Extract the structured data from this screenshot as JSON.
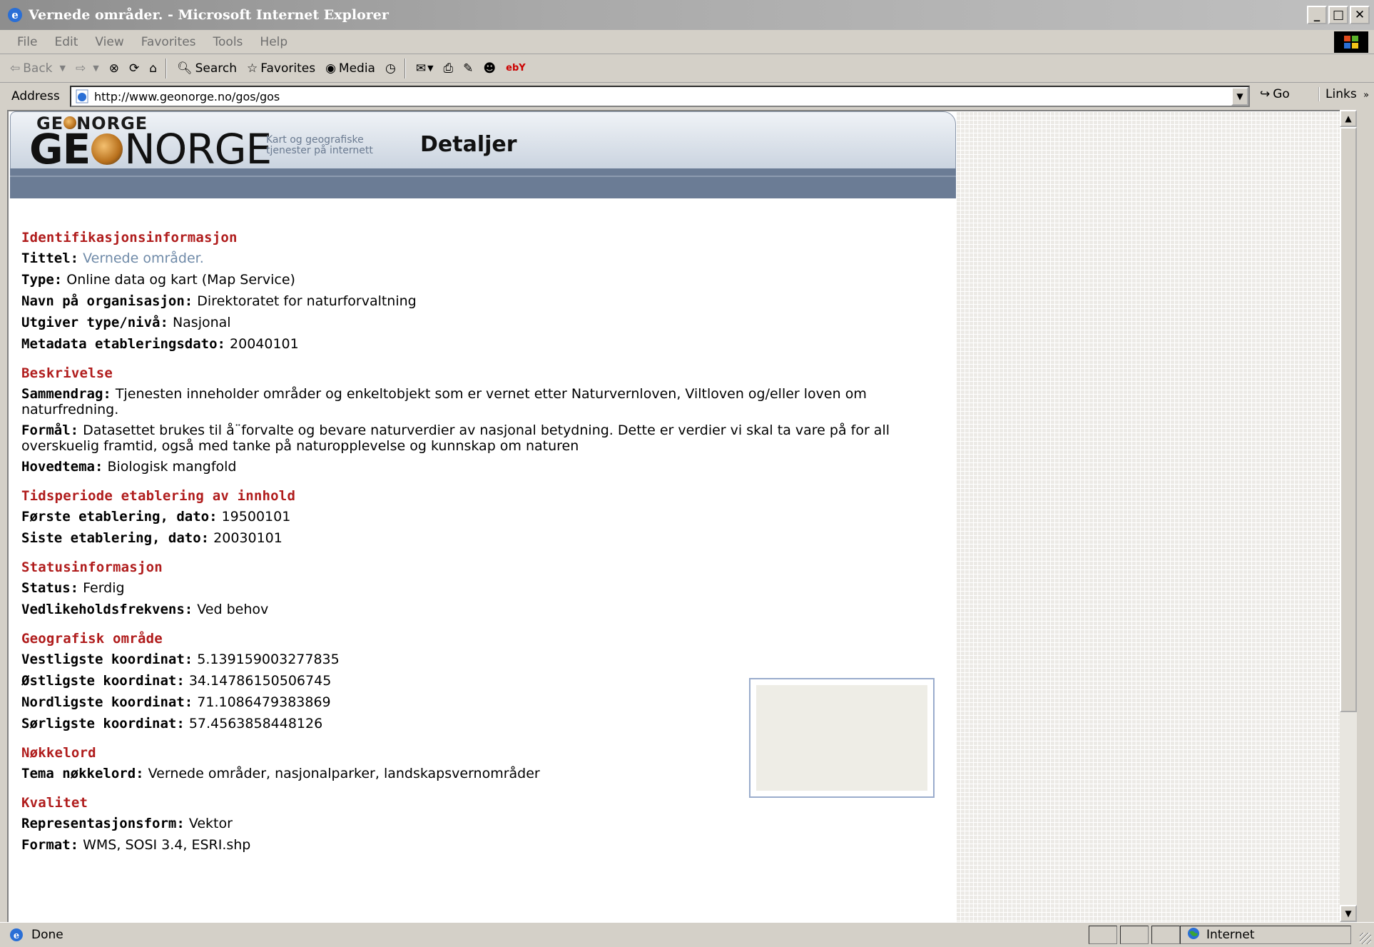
{
  "window": {
    "title": "Vernede områder. - Microsoft Internet Explorer"
  },
  "menu": [
    "File",
    "Edit",
    "View",
    "Favorites",
    "Tools",
    "Help"
  ],
  "toolbar": {
    "back": "Back",
    "search": "Search",
    "favorites": "Favorites",
    "media": "Media",
    "ebay": "ebY"
  },
  "address": {
    "label": "Address",
    "url": "http://www.geonorge.no/gos/gos",
    "go": "Go",
    "links": "Links"
  },
  "banner": {
    "small_logo": "GEONORGE",
    "big_logo_pre": "GE",
    "big_logo_post": "NORGE",
    "small_pre": "GE",
    "small_post": "NORGE",
    "tagline_1": "Kart og geografiske",
    "tagline_2": "tjenester på internett",
    "page_title": "Detaljer"
  },
  "sections": {
    "ident": {
      "heading": "Identifikasjonsinformasjon",
      "tittel_k": "Tittel:",
      "tittel_v": "Vernede områder.",
      "type_k": "Type:",
      "type_v": "Online data og kart (Map Service)",
      "org_k": "Navn på organisasjon:",
      "org_v": "Direktoratet for naturforvaltning",
      "utg_k": "Utgiver type/nivå:",
      "utg_v": "Nasjonal",
      "meta_k": "Metadata etableringsdato:",
      "meta_v": "20040101"
    },
    "beskr": {
      "heading": "Beskrivelse",
      "samm_k": "Sammendrag:",
      "samm_v": "Tjenesten inneholder områder og enkeltobjekt som er vernet etter Naturvernloven, Viltloven og/eller loven om naturfredning.",
      "form_k": "Formål:",
      "form_v": "Datasettet brukes til å¨forvalte og bevare naturverdier av nasjonal betydning. Dette er verdier vi skal ta vare på for all overskuelig framtid, også med tanke på naturopplevelse og kunnskap om naturen",
      "hoved_k": "Hovedtema:",
      "hoved_v": "Biologisk mangfold"
    },
    "tid": {
      "heading": "Tidsperiode etablering av innhold",
      "forste_k": "Første etablering, dato:",
      "forste_v": "19500101",
      "siste_k": "Siste etablering, dato:",
      "siste_v": "20030101"
    },
    "status": {
      "heading": "Statusinformasjon",
      "status_k": "Status:",
      "status_v": "Ferdig",
      "vedl_k": "Vedlikeholdsfrekvens:",
      "vedl_v": "Ved behov"
    },
    "geo": {
      "heading": "Geografisk område",
      "vest_k": "Vestligste koordinat:",
      "vest_v": "5.139159003277835",
      "ost_k": "Østligste koordinat:",
      "ost_v": "34.14786150506745",
      "nord_k": "Nordligste koordinat:",
      "nord_v": "71.1086479383869",
      "sor_k": "Sørligste koordinat:",
      "sor_v": "57.4563858448126"
    },
    "nokkel": {
      "heading": "Nøkkelord",
      "tema_k": "Tema nøkkelord:",
      "tema_v": "Vernede områder, nasjonalparker, landskapsvernområder"
    },
    "kval": {
      "heading": "Kvalitet",
      "rep_k": "Representasjonsform:",
      "rep_v": "Vektor",
      "fmt_k": "Format:",
      "fmt_v": "WMS, SOSI 3.4, ESRI.shp"
    }
  },
  "status": {
    "text": "Done",
    "zone": "Internet"
  }
}
